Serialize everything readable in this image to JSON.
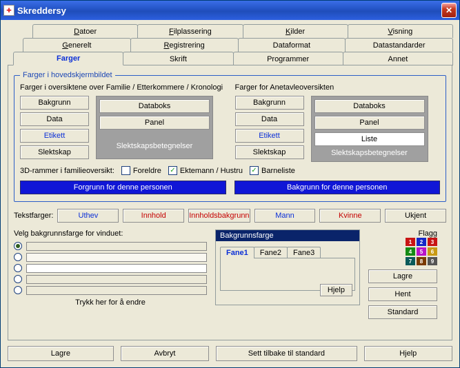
{
  "window": {
    "title": "Skreddersy"
  },
  "tabs_row1": [
    {
      "label": "Datoer",
      "ul": "D"
    },
    {
      "label": "Filplassering",
      "ul": "F"
    },
    {
      "label": "Kilder",
      "ul": "K"
    },
    {
      "label": "Visning",
      "ul": "V"
    }
  ],
  "tabs_row2": [
    {
      "label": "Generelt",
      "ul": "G"
    },
    {
      "label": "Registrering",
      "ul": "R"
    },
    {
      "label": "Dataformat",
      "ul": ""
    },
    {
      "label": "Datastandarder",
      "ul": ""
    }
  ],
  "tabs_row3": [
    {
      "label": "Farger",
      "ul": "",
      "active": true
    },
    {
      "label": "Skrift",
      "ul": ""
    },
    {
      "label": "Programmer",
      "ul": ""
    },
    {
      "label": "Annet",
      "ul": ""
    }
  ],
  "group": {
    "legend": "Farger i hovedskjermbildet",
    "left_header": "Farger i oversiktene over Familie / Etterkommere / Kronologi",
    "right_header": "Farger for Anetavleoversikten"
  },
  "left_buttons": [
    "Bakgrunn",
    "Data",
    "Etikett",
    "Slektskap"
  ],
  "left_panel": {
    "databoks": "Databoks",
    "panel": "Panel",
    "footer": "Slektskapsbetegnelser"
  },
  "right_buttons": [
    "Bakgrunn",
    "Data",
    "Etikett",
    "Slektskap"
  ],
  "right_panel": {
    "databoks": "Databoks",
    "panel": "Panel",
    "liste": "Liste",
    "footer": "Slektskapsbetegnelser"
  },
  "checks": {
    "lead": "3D-rammer i familieoversikt:",
    "foreldre": "Foreldre",
    "ektemann": "Ektemann / Hustru",
    "barneliste": "Barneliste"
  },
  "bigblue": {
    "forgrunn": "Forgrunn for denne personen",
    "bakgrunn": "Bakgrunn for denne personen"
  },
  "textcolors": {
    "label": "Tekstfarger:",
    "uthev": "Uthev",
    "innhold": "Innhold",
    "innholdsbakgrunn": "Innholdsbakgrunn",
    "mann": "Mann",
    "kvinne": "Kvinne",
    "ukjent": "Ukjent"
  },
  "bgselect": {
    "header": "Velg bakgrunnsfarge for vinduet:",
    "trykk": "Trykk her for å endre"
  },
  "preview": {
    "title": "Bakgrunnsfarge",
    "tab1": "Fane1",
    "tab2": "Fane2",
    "tab3": "Fane3",
    "hjelp": "Hjelp"
  },
  "flagg": {
    "label": "Flagg",
    "cells": [
      "1",
      "2",
      "3",
      "4",
      "5",
      "6",
      "7",
      "8",
      "9"
    ]
  },
  "sidebuttons": {
    "lagre": "Lagre",
    "hent": "Hent",
    "standard": "Standard"
  },
  "bottom": {
    "lagre": "Lagre",
    "avbryt": "Avbryt",
    "sett": "Sett tilbake til standard",
    "hjelp": "Hjelp"
  }
}
